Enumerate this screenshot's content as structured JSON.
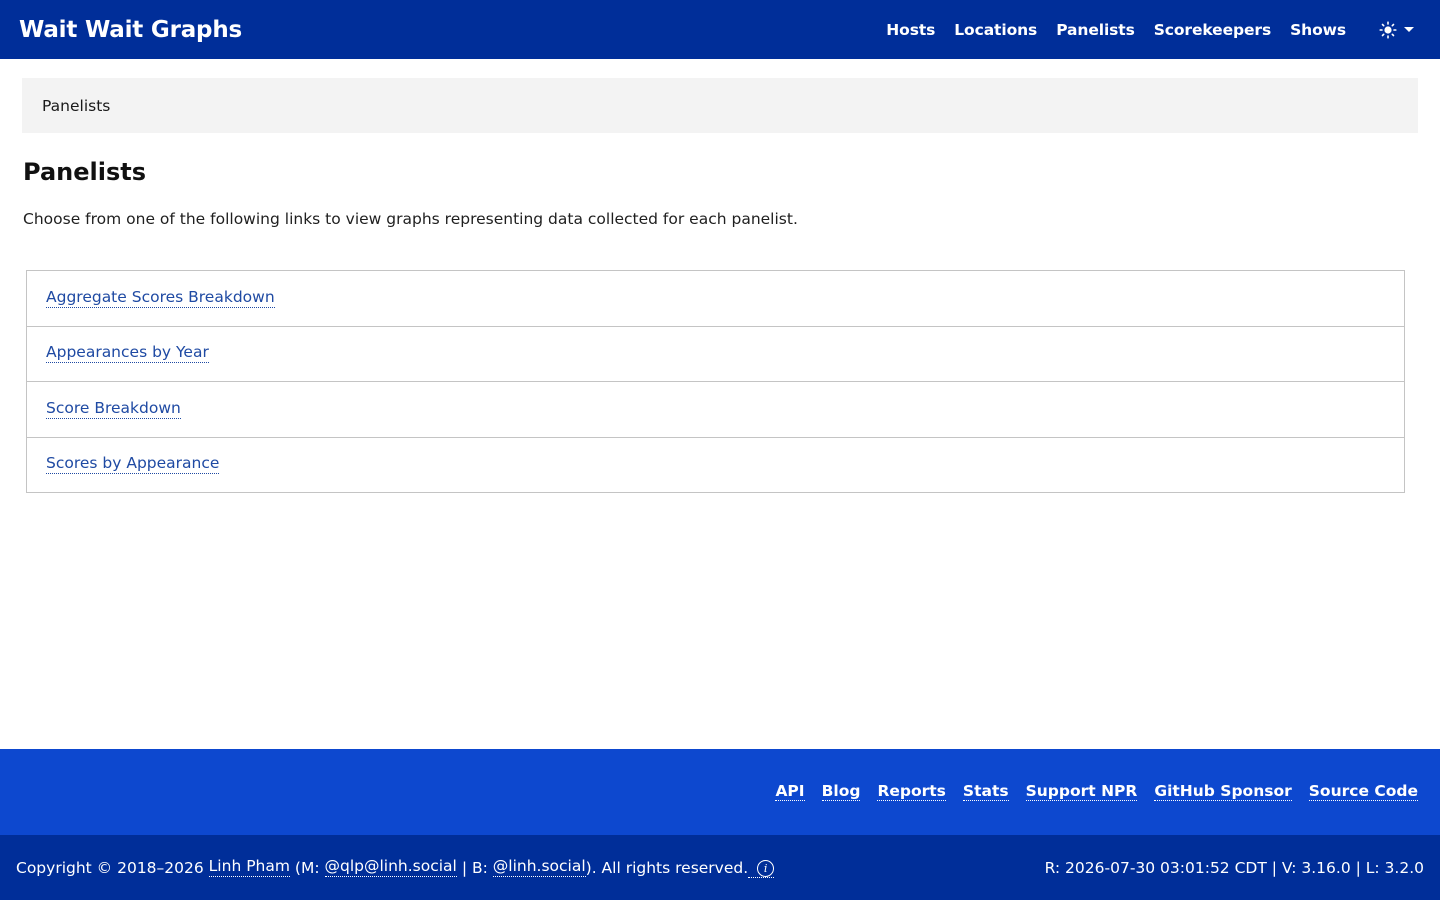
{
  "navbar": {
    "brand": "Wait Wait Graphs",
    "links": [
      "Hosts",
      "Locations",
      "Panelists",
      "Scorekeepers",
      "Shows"
    ],
    "theme_icon": "sun-icon"
  },
  "breadcrumb": {
    "current": "Panelists"
  },
  "main": {
    "title": "Panelists",
    "intro": "Choose from one of the following links to view graphs representing data collected for each panelist.",
    "links": [
      "Aggregate Scores Breakdown",
      "Appearances by Year",
      "Score Breakdown",
      "Scores by Appearance"
    ]
  },
  "footer": {
    "links": [
      "API",
      "Blog",
      "Reports",
      "Stats",
      "Support NPR",
      "GitHub Sponsor",
      "Source Code"
    ],
    "copyright_prefix": "Copyright © 2018–2026",
    "author": "Linh Pham",
    "mastodon_prefix": "(M:",
    "mastodon": "@qlp@linh.social",
    "bluesky_prefix": "| B:",
    "bluesky": "@linh.social",
    "rights": "). All rights reserved.",
    "info_icon": "info-icon",
    "release": "R: 2026-07-30 03:01:52 CDT | V: 3.16.0 | L: 3.2.0"
  },
  "colors": {
    "navbar_bg": "#002e99",
    "footer_top_bg": "#0d48cf",
    "link": "#1f4aa3",
    "breadcrumb_bg": "#f3f3f3"
  }
}
